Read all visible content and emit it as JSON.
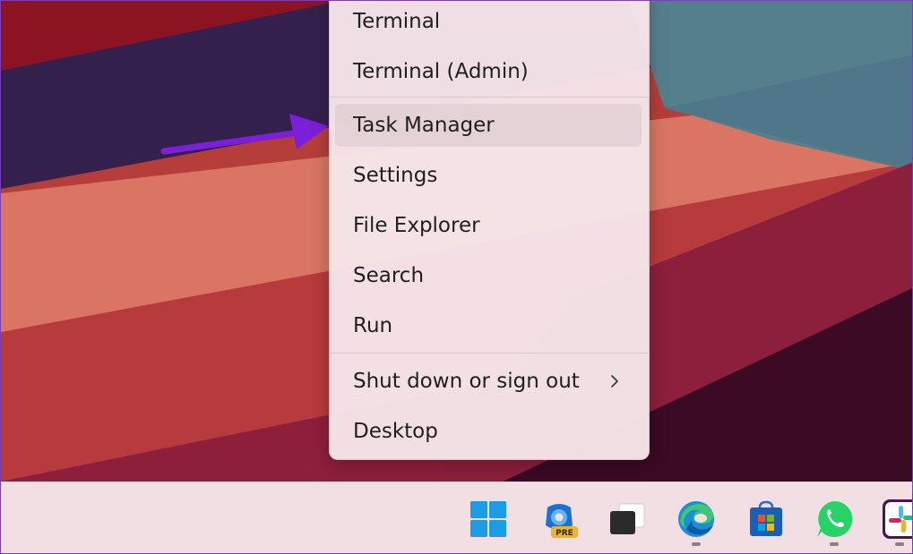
{
  "context_menu": {
    "items": [
      {
        "label": "Terminal"
      },
      {
        "label": "Terminal (Admin)"
      },
      {
        "label": "Task Manager"
      },
      {
        "label": "Settings"
      },
      {
        "label": "File Explorer"
      },
      {
        "label": "Search"
      },
      {
        "label": "Run"
      },
      {
        "label": "Shut down or sign out"
      },
      {
        "label": "Desktop"
      }
    ],
    "highlighted_item": "Task Manager"
  },
  "annotation": {
    "color": "#7b1fd8"
  },
  "taskbar": {
    "icons": [
      {
        "name": "windows-start-icon"
      },
      {
        "name": "outlook-preview-icon",
        "badge": "PRE"
      },
      {
        "name": "task-view-icon"
      },
      {
        "name": "edge-icon"
      },
      {
        "name": "microsoft-store-icon"
      },
      {
        "name": "whatsapp-icon"
      },
      {
        "name": "slack-icon"
      }
    ]
  }
}
